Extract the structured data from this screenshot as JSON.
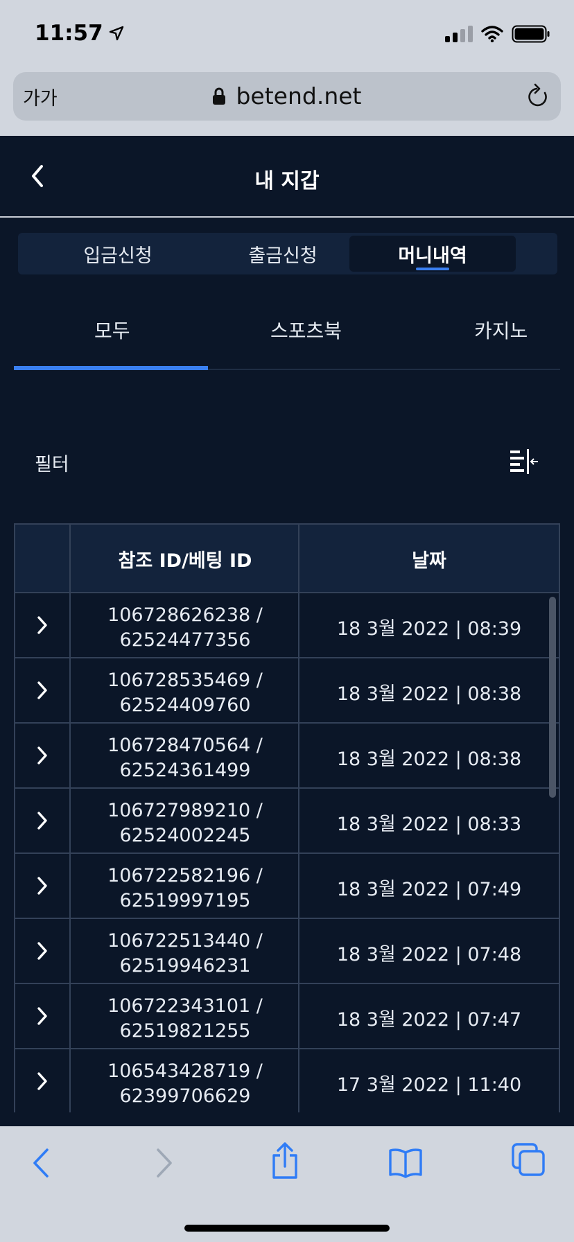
{
  "status_bar": {
    "time": "11:57"
  },
  "browser": {
    "text_size_label": "가가",
    "url": "betend.net"
  },
  "header": {
    "title": "내 지갑"
  },
  "segments": [
    {
      "label": "입금신청",
      "active": false
    },
    {
      "label": "출금신청",
      "active": false
    },
    {
      "label": "머니내역",
      "active": true
    }
  ],
  "subtabs": [
    {
      "label": "모두",
      "active": true
    },
    {
      "label": "스포츠북",
      "active": false
    },
    {
      "label": "카지노",
      "active": false
    }
  ],
  "filter": {
    "label": "필터"
  },
  "table": {
    "headers": [
      "",
      "참조 ID/베팅 ID",
      "날짜"
    ],
    "rows": [
      {
        "ref_id": "106728626238 /",
        "bet_id": "62524477356",
        "date": "18 3월 2022 | 08:39"
      },
      {
        "ref_id": "106728535469 /",
        "bet_id": "62524409760",
        "date": "18 3월 2022 | 08:38"
      },
      {
        "ref_id": "106728470564 /",
        "bet_id": "62524361499",
        "date": "18 3월 2022 | 08:38"
      },
      {
        "ref_id": "106727989210 /",
        "bet_id": "62524002245",
        "date": "18 3월 2022 | 08:33"
      },
      {
        "ref_id": "106722582196 /",
        "bet_id": "62519997195",
        "date": "18 3월 2022 | 07:49"
      },
      {
        "ref_id": "106722513440 /",
        "bet_id": "62519946231",
        "date": "18 3월 2022 | 07:48"
      },
      {
        "ref_id": "106722343101 /",
        "bet_id": "62519821255",
        "date": "18 3월 2022 | 07:47"
      },
      {
        "ref_id": "106543428719 /",
        "bet_id": "62399706629",
        "date": "17 3월 2022 | 11:40"
      }
    ]
  },
  "colors": {
    "background": "#0b1628",
    "panel": "#13233c",
    "accent": "#3a7ff0",
    "border": "#334158",
    "safari_bar": "#d1d6de",
    "safari_icon": "#2f7cf6"
  },
  "icons": {
    "status": [
      "location-arrow-icon",
      "signal-icon",
      "wifi-icon",
      "battery-icon"
    ],
    "browser": [
      "lock-icon",
      "reload-icon"
    ],
    "toolbar": [
      "back-icon",
      "forward-icon",
      "share-icon",
      "bookmarks-icon",
      "tabs-icon"
    ]
  }
}
